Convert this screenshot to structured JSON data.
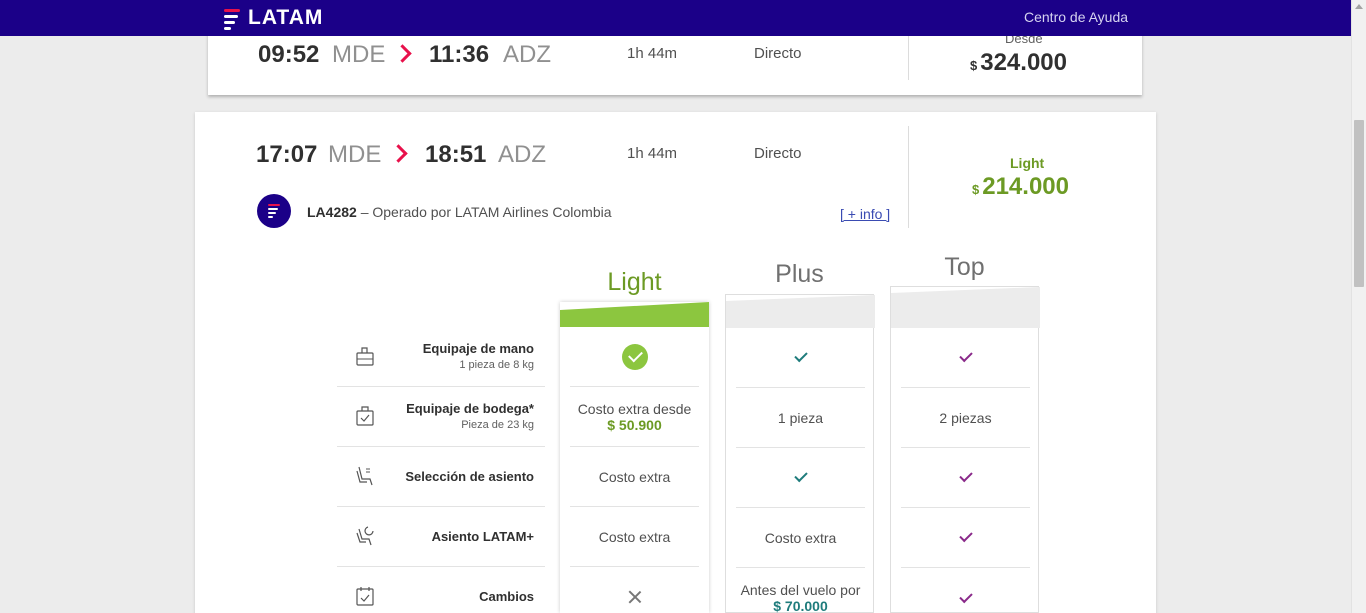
{
  "header": {
    "brand": "LATAM",
    "help_link": "Centro de Ayuda"
  },
  "flights": [
    {
      "depart_time": "09:52",
      "depart_code": "MDE",
      "arrive_time": "11:36",
      "arrive_code": "ADZ",
      "duration": "1h 44m",
      "stops": "Directo",
      "price_label": "Desde",
      "currency": "$",
      "price": "324.000"
    },
    {
      "depart_time": "17:07",
      "depart_code": "MDE",
      "arrive_time": "18:51",
      "arrive_code": "ADZ",
      "duration": "1h 44m",
      "stops": "Directo",
      "price_label": "Light",
      "currency": "$",
      "price": "214.000",
      "flight_number": "LA4282",
      "operator": " – Operado por LATAM Airlines Colombia",
      "more_info": "[ + info ]"
    }
  ],
  "fares": {
    "names": [
      "Light",
      "Plus",
      "Top"
    ],
    "features": [
      {
        "title": "Equipaje de mano",
        "sub": "1 pieza de 8 kg",
        "icon": "carry-on-bag-icon"
      },
      {
        "title": "Equipaje de bodega*",
        "sub": "Pieza de 23 kg",
        "icon": "checked-bag-icon"
      },
      {
        "title": "Selección de asiento",
        "sub": "",
        "icon": "seat-icon"
      },
      {
        "title": "Asiento LATAM+",
        "sub": "",
        "icon": "seat-plus-icon"
      },
      {
        "title": "Cambios",
        "sub": "",
        "icon": "calendar-check-icon"
      }
    ],
    "light": {
      "bodega_line1": "Costo extra desde",
      "bodega_amount": "$ 50.900",
      "seleccion": "Costo extra",
      "asiento_plus": "Costo extra"
    },
    "plus": {
      "bodega": "1 pieza",
      "asiento_plus": "Costo extra",
      "cambios_line1": "Antes del vuelo por",
      "cambios_amount": "$ 70.000"
    },
    "top": {
      "bodega": "2 piezas"
    }
  },
  "colors": {
    "header": "#1b0088",
    "accent_red": "#e8114b",
    "light_green": "#8cc63f",
    "price_green": "#6c9a24"
  }
}
